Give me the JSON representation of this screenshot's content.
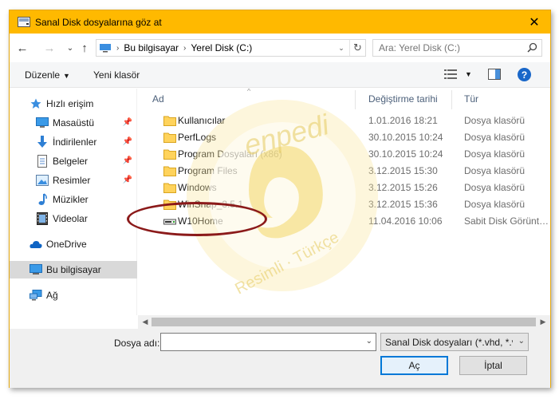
{
  "window": {
    "title": "Sanal Disk dosyalarına göz at",
    "accent": "#ffb900"
  },
  "address": {
    "crumbs": [
      "Bu bilgisayar",
      "Yerel Disk (C:)"
    ],
    "search_placeholder": "Ara: Yerel Disk (C:)"
  },
  "toolbar": {
    "organize_label": "Düzenle",
    "new_folder_label": "Yeni klasör",
    "help_label": "?"
  },
  "sidebar": {
    "items": [
      {
        "label": "Hızlı erişim",
        "icon": "star-icon"
      },
      {
        "label": "Masaüstü",
        "icon": "desktop-icon"
      },
      {
        "label": "İndirilenler",
        "icon": "download-icon"
      },
      {
        "label": "Belgeler",
        "icon": "documents-icon"
      },
      {
        "label": "Resimler",
        "icon": "pictures-icon"
      },
      {
        "label": "Müzikler",
        "icon": "music-icon"
      },
      {
        "label": "Videolar",
        "icon": "video-icon"
      },
      {
        "label": "OneDrive",
        "icon": "cloud-icon"
      },
      {
        "label": "Bu bilgisayar",
        "icon": "computer-icon"
      },
      {
        "label": "Ağ",
        "icon": "network-icon"
      }
    ]
  },
  "columns": {
    "name": "Ad",
    "date": "Değiştirme tarihi",
    "type": "Tür"
  },
  "files": [
    {
      "name": "Kullanıcılar",
      "date": "1.01.2016 18:21",
      "type": "Dosya klasörü",
      "icon": "folder-icon"
    },
    {
      "name": "PerfLogs",
      "date": "30.10.2015 10:24",
      "type": "Dosya klasörü",
      "icon": "folder-icon"
    },
    {
      "name": "Program Dosyaları (x86)",
      "date": "30.10.2015 10:24",
      "type": "Dosya klasörü",
      "icon": "folder-icon"
    },
    {
      "name": "Program Files",
      "date": "3.12.2015 15:30",
      "type": "Dosya klasörü",
      "icon": "folder-icon"
    },
    {
      "name": "Windows",
      "date": "3.12.2015 15:26",
      "type": "Dosya klasörü",
      "icon": "folder-icon"
    },
    {
      "name": "WinSnap_3.5.1",
      "date": "3.12.2015 15:36",
      "type": "Dosya klasörü",
      "icon": "folder-icon"
    },
    {
      "name": "W10Home",
      "date": "11.04.2016 10:06",
      "type": "Sabit Disk Görünt…",
      "icon": "disk-image-icon"
    }
  ],
  "bottom": {
    "filename_label": "Dosya adı:",
    "filename_value": "",
    "filetype_value": "Sanal Disk dosyaları (*.vhd, *.vhd",
    "open_label": "Aç",
    "cancel_label": "İptal"
  },
  "watermark": {
    "brand": "enpedi",
    "tagline": "Resimli · Türkçe"
  }
}
